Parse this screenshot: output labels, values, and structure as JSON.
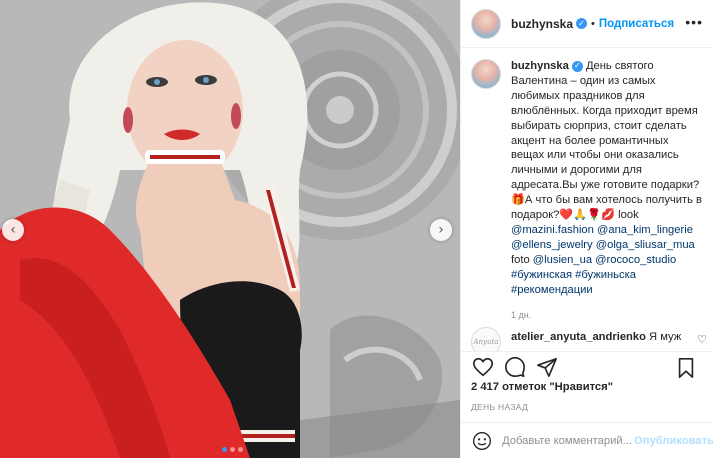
{
  "post": {
    "username": "buzhynska",
    "follow_label": "Подписаться",
    "more_label": "•••",
    "caption_text": "День святого Валентина – один из самых любимых праздников для влюблённых. Когда приходит время выбирать сюрприз, стоит сделать акцент на более романтичных вещах или чтобы они оказались личными и дорогими для адресата.Вы уже готовите подарки?🎁А что бы вам хотелось получить в подарок?❤️🙏🌹💋 look",
    "tags": {
      "t1": "@mazini.fashion",
      "t2": "@ana_kim_lingerie",
      "t3": "@ellens_jewelry",
      "t4": "@olga_sliusar_mua",
      "foto": "foto",
      "t5": "@lusien_ua",
      "t6": "@rococo_studio",
      "h1": "#бужинская",
      "h2": "#бужиньска",
      "h3": "#рекомендации"
    },
    "caption_time": "1 дн.",
    "comment": {
      "username": "atelier_anyuta_andrienko",
      "text": "Я мужу",
      "avatar_text": "Anyuta"
    },
    "likes_count": "2 417 отметок",
    "likes_suffix": "\"Нравится\"",
    "posted": "ДЕНЬ НАЗАД",
    "comment_placeholder": "Добавьте комментарий...",
    "publish_label": "Опубликовать"
  },
  "carousel": {
    "total": 3,
    "active": 1
  },
  "icons": {
    "nav_prev": "chevron-left-icon",
    "nav_next": "chevron-right-icon",
    "like": "heart-icon",
    "comment": "comment-icon",
    "share": "send-icon",
    "save": "bookmark-icon",
    "emoji": "smile-icon",
    "verified": "verified-badge-icon"
  },
  "colors": {
    "link": "#00376b",
    "follow": "#0095f6",
    "verified": "#3897f0",
    "dress_red": "#e02a2a"
  }
}
